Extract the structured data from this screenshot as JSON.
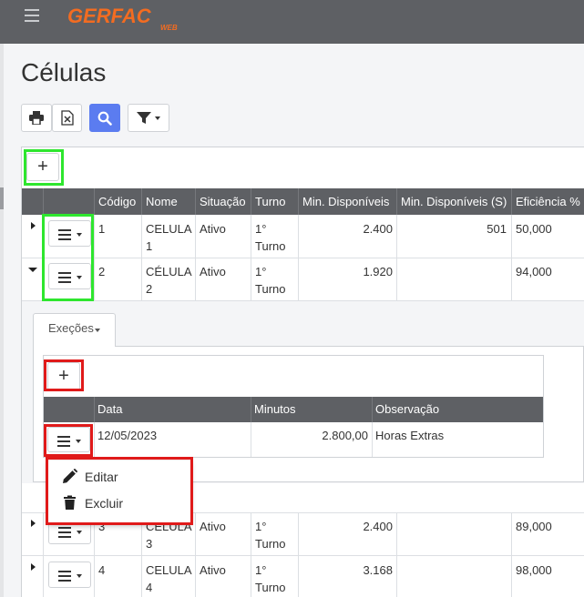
{
  "app": {
    "logo_text": "GERFAC",
    "logo_sub": "WEB"
  },
  "page": {
    "title": "Células"
  },
  "toolbar": {
    "print_icon": "printer-icon",
    "excel_icon": "excel-icon",
    "search_icon": "search-icon",
    "filter_icon": "filter-icon",
    "accent_color": "#5b7cf0"
  },
  "table": {
    "add_label": "+",
    "columns": [
      "Código",
      "Nome",
      "Situação",
      "Turno",
      "Min. Disponíveis",
      "Min. Disponíveis (S)",
      "Eficiência %"
    ],
    "rows": [
      {
        "codigo": "1",
        "nome": "CELULA 1",
        "nome_l1": "CELULA",
        "nome_l2": "1",
        "situacao": "Ativo",
        "turno_l1": "1°",
        "turno_l2": "Turno",
        "min_disp": "2.400",
        "min_disp_s": "501",
        "eficiencia": "50,000"
      },
      {
        "codigo": "2",
        "nome": "CÉLULA 2",
        "nome_l1": "CÉLULA",
        "nome_l2": "2",
        "situacao": "Ativo",
        "turno_l1": "1°",
        "turno_l2": "Turno",
        "min_disp": "1.920",
        "min_disp_s": "",
        "eficiencia": "94,000"
      },
      {
        "codigo": "3",
        "nome": "CELULA 3",
        "nome_l1": "CELULA",
        "nome_l2": "3",
        "situacao": "Ativo",
        "turno_l1": "1°",
        "turno_l2": "Turno",
        "min_disp": "2.400",
        "min_disp_s": "",
        "eficiencia": "89,000"
      },
      {
        "codigo": "4",
        "nome": "CELULA 4",
        "nome_l1": "CELULA",
        "nome_l2": "4",
        "situacao": "Ativo",
        "turno_l1": "1°",
        "turno_l2": "Turno",
        "min_disp": "3.168",
        "min_disp_s": "",
        "eficiencia": "98,000"
      }
    ]
  },
  "detail": {
    "tab_label": "Exeções",
    "add_label": "+",
    "columns": [
      "Data",
      "Minutos",
      "Observação"
    ],
    "rows": [
      {
        "data": "12/05/2023",
        "minutos": "2.800,00",
        "observacao": "Horas Extras"
      }
    ],
    "menu": {
      "edit_label": "Editar",
      "delete_label": "Excluir"
    }
  },
  "highlights": {
    "green": "#2ee62e",
    "red": "#e01a1a"
  }
}
